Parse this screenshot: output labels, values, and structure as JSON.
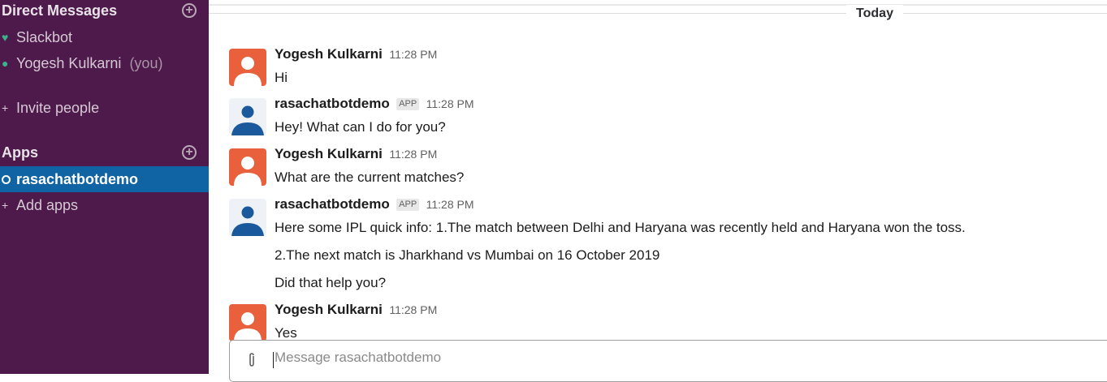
{
  "sidebar": {
    "direct_messages_header": "Direct Messages",
    "dm_items": [
      {
        "label": "Slackbot",
        "icon": "heart-icon"
      },
      {
        "label": "Yogesh Kulkarni",
        "suffix": "(you)",
        "icon": "presence-icon"
      }
    ],
    "invite_label": "Invite people",
    "apps_header": "Apps",
    "active_app": "rasachatbotdemo",
    "add_apps_label": "Add apps"
  },
  "channel": {
    "date_divider": "Today"
  },
  "messages": [
    {
      "author": "Yogesh Kulkarni",
      "time": "11:28 PM",
      "avatar": "orange-person-avatar",
      "lines": [
        "Hi"
      ]
    },
    {
      "author": "rasachatbotdemo",
      "badge": "APP",
      "time": "11:28 PM",
      "avatar": "blue-person-avatar",
      "lines": [
        "Hey! What can I do for you?"
      ]
    },
    {
      "author": "Yogesh Kulkarni",
      "time": "11:28 PM",
      "avatar": "orange-person-avatar",
      "lines": [
        "What are the current matches?"
      ]
    },
    {
      "author": "rasachatbotdemo",
      "badge": "APP",
      "time": "11:28 PM",
      "avatar": "blue-person-avatar",
      "lines": [
        "Here some IPL quick info: 1.The match between Delhi and Haryana was recently held and Haryana won the toss.",
        "2.The next match is Jharkhand vs Mumbai on 16 October 2019",
        "Did that help you?"
      ]
    },
    {
      "author": "Yogesh Kulkarni",
      "time": "11:28 PM",
      "avatar": "orange-person-avatar",
      "lines": [
        "Yes"
      ]
    }
  ],
  "composer": {
    "placeholder": "Message rasachatbotdemo",
    "value": ""
  },
  "colors": {
    "sidebar_bg": "#4d1a4b",
    "active_item_bg": "#1164a3",
    "orange_avatar": "#e8603c",
    "blue_avatar": "#1a5a9c"
  }
}
